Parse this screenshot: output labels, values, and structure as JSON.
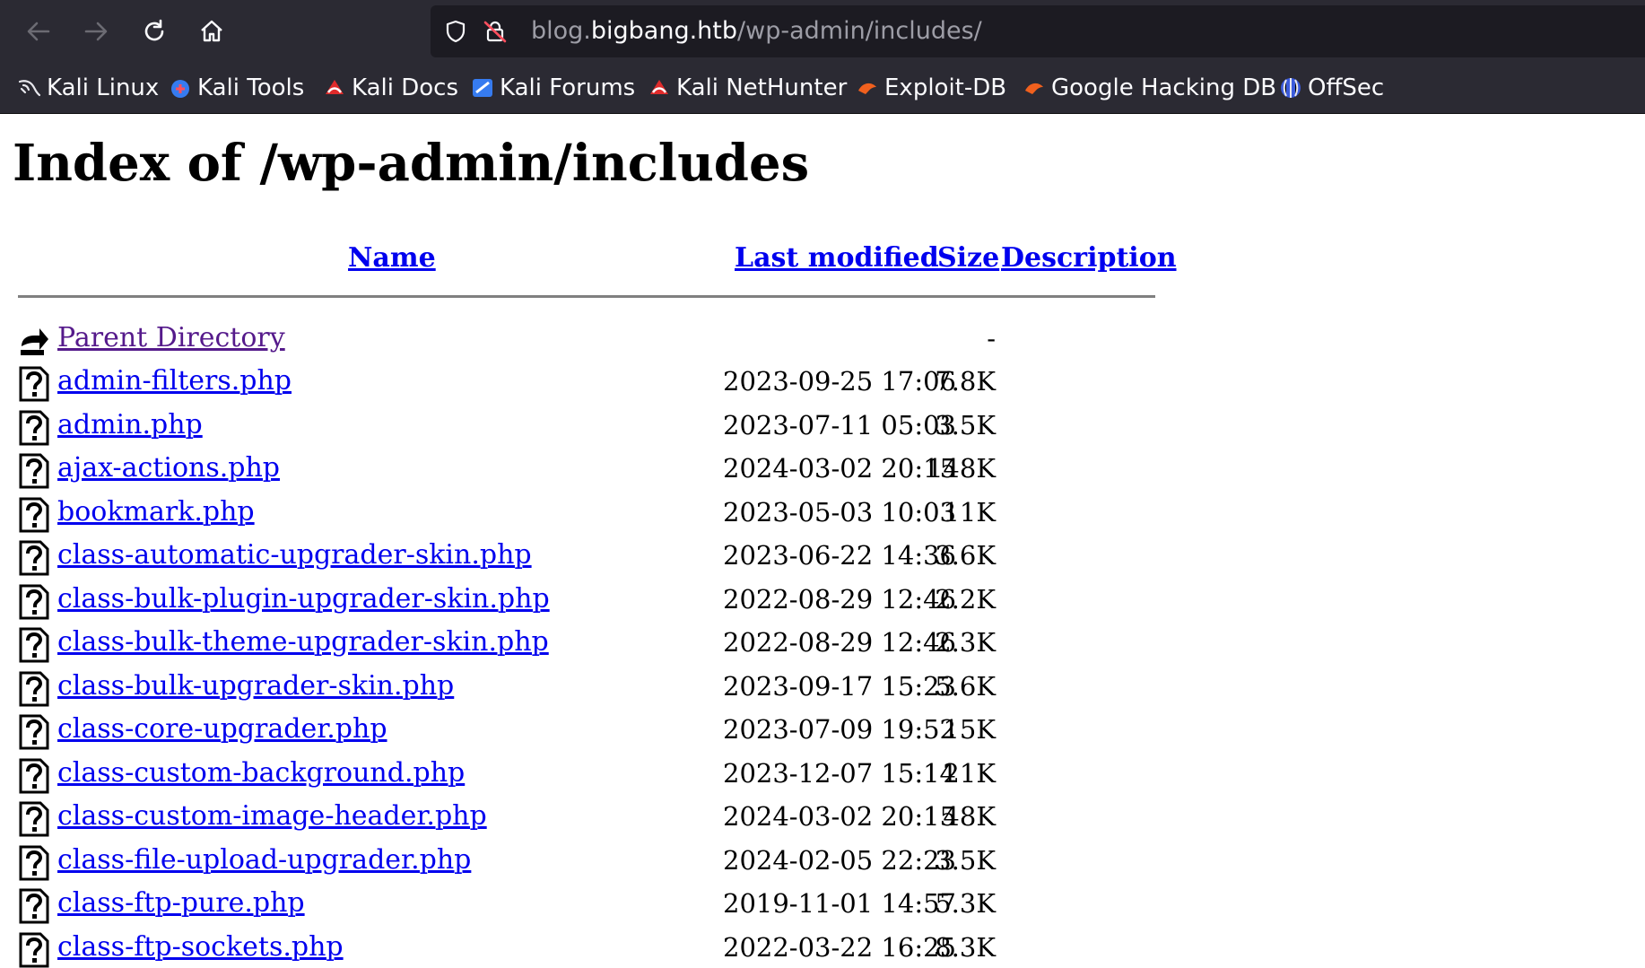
{
  "browser": {
    "url": {
      "pre": "blog.",
      "domain": "bigbang.htb",
      "path": "/wp-admin/includes/"
    },
    "bookmarks": [
      {
        "label": "Kali Linux",
        "icon": "kali-dragon-icon"
      },
      {
        "label": "Kali Tools",
        "icon": "kali-tools-icon"
      },
      {
        "label": "Kali Docs",
        "icon": "kali-docs-icon"
      },
      {
        "label": "Kali Forums",
        "icon": "kali-forums-icon"
      },
      {
        "label": "Kali NetHunter",
        "icon": "kali-nethunter-icon"
      },
      {
        "label": "Exploit-DB",
        "icon": "exploit-db-icon"
      },
      {
        "label": "Google Hacking DB",
        "icon": "ghdb-icon"
      },
      {
        "label": "OffSec",
        "icon": "offsec-icon"
      }
    ],
    "colors": {
      "toolbar": "#2b2a33",
      "urlbar": "#1c1b22"
    }
  },
  "page": {
    "title": "Index of /wp-admin/includes",
    "headers": {
      "name": "Name",
      "last_modified": "Last modified",
      "size": "Size",
      "description": "Description"
    },
    "parent": {
      "label": "Parent Directory",
      "size": "-"
    },
    "rows": [
      {
        "name": "admin-filters.php",
        "date": "2023-09-25 17:06",
        "size": "7.8K"
      },
      {
        "name": "admin.php",
        "date": "2023-07-11 05:03",
        "size": "3.5K"
      },
      {
        "name": "ajax-actions.php",
        "date": "2024-03-02 20:15",
        "size": "148K"
      },
      {
        "name": "bookmark.php",
        "date": "2023-05-03 10:03",
        "size": "11K"
      },
      {
        "name": "class-automatic-upgrader-skin.php",
        "date": "2023-06-22 14:36",
        "size": "3.6K"
      },
      {
        "name": "class-bulk-plugin-upgrader-skin.php",
        "date": "2022-08-29 12:46",
        "size": "2.2K"
      },
      {
        "name": "class-bulk-theme-upgrader-skin.php",
        "date": "2022-08-29 12:46",
        "size": "2.3K"
      },
      {
        "name": "class-bulk-upgrader-skin.php",
        "date": "2023-09-17 15:23",
        "size": "5.6K"
      },
      {
        "name": "class-core-upgrader.php",
        "date": "2023-07-09 19:52",
        "size": "15K"
      },
      {
        "name": "class-custom-background.php",
        "date": "2023-12-07 15:14",
        "size": "21K"
      },
      {
        "name": "class-custom-image-header.php",
        "date": "2024-03-02 20:15",
        "size": "48K"
      },
      {
        "name": "class-file-upload-upgrader.php",
        "date": "2024-02-05 22:23",
        "size": "3.5K"
      },
      {
        "name": "class-ftp-pure.php",
        "date": "2019-11-01 14:57",
        "size": "5.3K"
      },
      {
        "name": "class-ftp-sockets.php",
        "date": "2022-03-22 16:25",
        "size": "8.3K"
      }
    ],
    "colors": {
      "link": "#0000ee",
      "visited": "#551a8b",
      "rule": "#808080"
    }
  }
}
